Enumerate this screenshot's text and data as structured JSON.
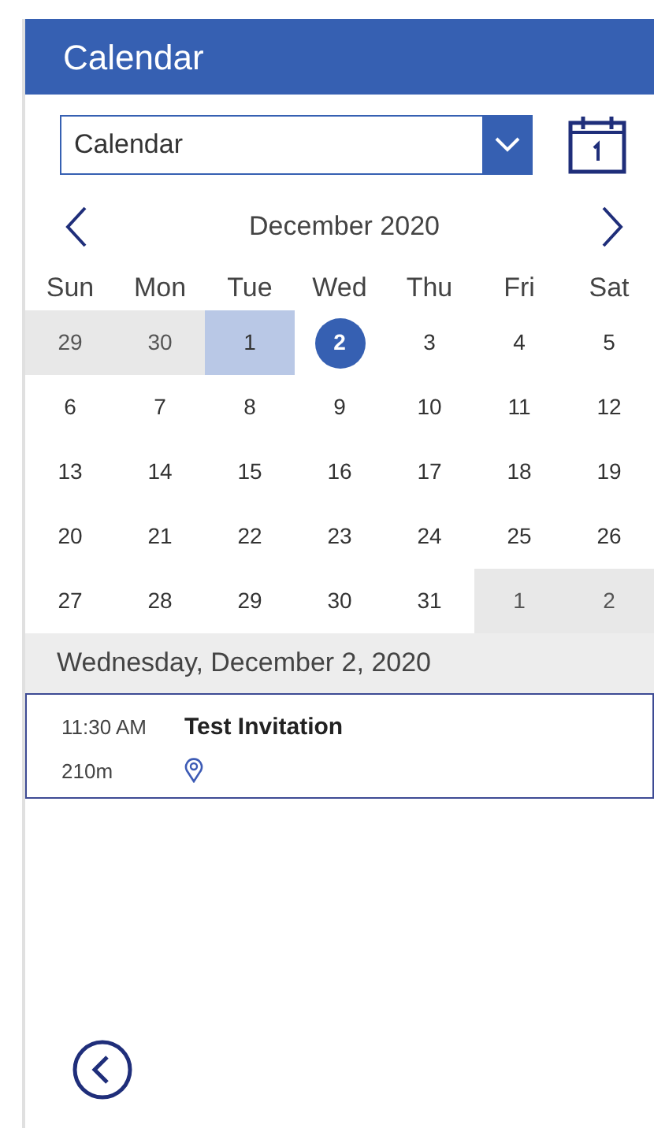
{
  "header": {
    "title": "Calendar"
  },
  "calendar_select": {
    "value": "Calendar"
  },
  "month_nav": {
    "title": "December 2020"
  },
  "weekdays": [
    "Sun",
    "Mon",
    "Tue",
    "Wed",
    "Thu",
    "Fri",
    "Sat"
  ],
  "days": [
    {
      "label": "29",
      "outside": true,
      "highlighted": false,
      "selected": false
    },
    {
      "label": "30",
      "outside": true,
      "highlighted": false,
      "selected": false
    },
    {
      "label": "1",
      "outside": false,
      "highlighted": true,
      "selected": false
    },
    {
      "label": "2",
      "outside": false,
      "highlighted": false,
      "selected": true
    },
    {
      "label": "3",
      "outside": false,
      "highlighted": false,
      "selected": false
    },
    {
      "label": "4",
      "outside": false,
      "highlighted": false,
      "selected": false
    },
    {
      "label": "5",
      "outside": false,
      "highlighted": false,
      "selected": false
    },
    {
      "label": "6",
      "outside": false,
      "highlighted": false,
      "selected": false
    },
    {
      "label": "7",
      "outside": false,
      "highlighted": false,
      "selected": false
    },
    {
      "label": "8",
      "outside": false,
      "highlighted": false,
      "selected": false
    },
    {
      "label": "9",
      "outside": false,
      "highlighted": false,
      "selected": false
    },
    {
      "label": "10",
      "outside": false,
      "highlighted": false,
      "selected": false
    },
    {
      "label": "11",
      "outside": false,
      "highlighted": false,
      "selected": false
    },
    {
      "label": "12",
      "outside": false,
      "highlighted": false,
      "selected": false
    },
    {
      "label": "13",
      "outside": false,
      "highlighted": false,
      "selected": false
    },
    {
      "label": "14",
      "outside": false,
      "highlighted": false,
      "selected": false
    },
    {
      "label": "15",
      "outside": false,
      "highlighted": false,
      "selected": false
    },
    {
      "label": "16",
      "outside": false,
      "highlighted": false,
      "selected": false
    },
    {
      "label": "17",
      "outside": false,
      "highlighted": false,
      "selected": false
    },
    {
      "label": "18",
      "outside": false,
      "highlighted": false,
      "selected": false
    },
    {
      "label": "19",
      "outside": false,
      "highlighted": false,
      "selected": false
    },
    {
      "label": "20",
      "outside": false,
      "highlighted": false,
      "selected": false
    },
    {
      "label": "21",
      "outside": false,
      "highlighted": false,
      "selected": false
    },
    {
      "label": "22",
      "outside": false,
      "highlighted": false,
      "selected": false
    },
    {
      "label": "23",
      "outside": false,
      "highlighted": false,
      "selected": false
    },
    {
      "label": "24",
      "outside": false,
      "highlighted": false,
      "selected": false
    },
    {
      "label": "25",
      "outside": false,
      "highlighted": false,
      "selected": false
    },
    {
      "label": "26",
      "outside": false,
      "highlighted": false,
      "selected": false
    },
    {
      "label": "27",
      "outside": false,
      "highlighted": false,
      "selected": false
    },
    {
      "label": "28",
      "outside": false,
      "highlighted": false,
      "selected": false
    },
    {
      "label": "29",
      "outside": false,
      "highlighted": false,
      "selected": false
    },
    {
      "label": "30",
      "outside": false,
      "highlighted": false,
      "selected": false
    },
    {
      "label": "31",
      "outside": false,
      "highlighted": false,
      "selected": false
    },
    {
      "label": "1",
      "outside": true,
      "highlighted": false,
      "selected": false
    },
    {
      "label": "2",
      "outside": true,
      "highlighted": false,
      "selected": false
    }
  ],
  "selected_date": "Wednesday, December 2, 2020",
  "events": [
    {
      "time": "11:30 AM",
      "title": "Test Invitation",
      "duration": "210m"
    }
  ]
}
